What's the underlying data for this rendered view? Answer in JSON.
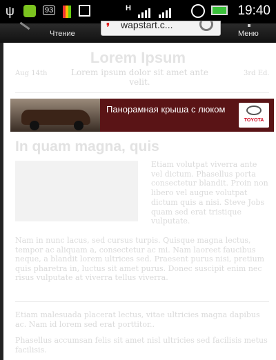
{
  "status_bar": {
    "notification_badge": "93",
    "clock": "19:40"
  },
  "toolbar": {
    "reading_label": "Чтение",
    "url_text": "wapstart.c...",
    "menu_label": "Меню"
  },
  "article": {
    "title": "Lorem Ipsum",
    "date": "Aug 14th",
    "subtitle": "Lorem ipsum dolor sit amet ante velit.",
    "edition": "3rd Ed."
  },
  "ad_banner": {
    "text": "Панорамная крыша с люком",
    "brand": "TOYOTA"
  },
  "section": {
    "heading": "In quam magna, quis",
    "float_text": "Etiam volutpat viverra ante vel dictum. Phasellus porta consectetur blandit. Proin non libero vel augue volutpat dictum quis a nisi. Steve Jobs quam sed erat tristique vulputate.",
    "paragraph1": "Nam in nunc lacus, sed cursus turpis. Quisque magna lectus, tempor ac aliquam a, consectetur ac mi. Nam laoreet faucibus neque, a blandit lorem ultrices sed. Praesent purus nisi, pretium quis pharetra in, luctus sit amet purus. Donec suscipit enim nec risus vulputate at viverra tellus viverra.",
    "paragraph2": "Etiam malesuada placerat lectus, vitae ultricies magna dapibus ac. Nam id lorem sed erat porttitor..",
    "paragraph3": "Phasellus accumsan felis sit amet nisl ultricies sed facilisis metus facilisis."
  },
  "colors": {
    "status_bar_bg": "#000000",
    "ad_bg": "#5a1416",
    "faded_text": "#dadada"
  }
}
